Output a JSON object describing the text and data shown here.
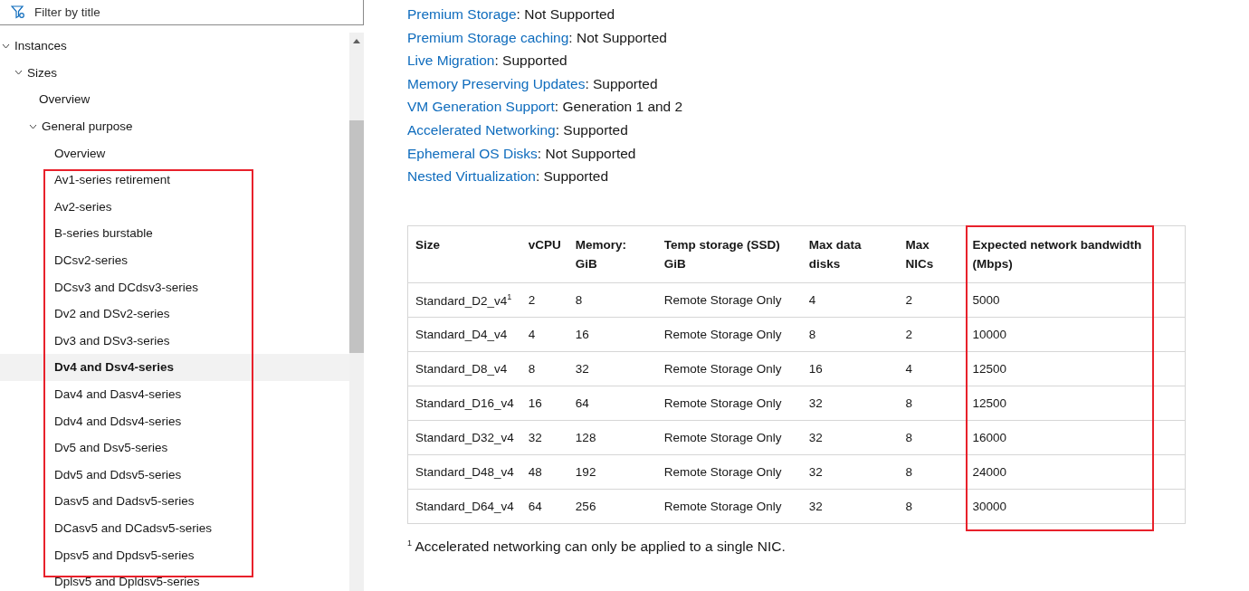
{
  "sidebar": {
    "filter": {
      "placeholder": "Filter by title"
    },
    "tree": [
      {
        "label": "Instances",
        "expanded": true,
        "selected": false,
        "children": [
          {
            "label": "Sizes",
            "expanded": true,
            "selected": false,
            "children": [
              {
                "label": "Overview",
                "selected": false
              },
              {
                "label": "General purpose",
                "expanded": true,
                "selected": false,
                "children": [
                  {
                    "label": "Overview",
                    "selected": false
                  },
                  {
                    "label": "Av1-series retirement",
                    "selected": false
                  },
                  {
                    "label": "Av2-series",
                    "selected": false
                  },
                  {
                    "label": "B-series burstable",
                    "selected": false
                  },
                  {
                    "label": "DCsv2-series",
                    "selected": false
                  },
                  {
                    "label": "DCsv3 and DCdsv3-series",
                    "selected": false
                  },
                  {
                    "label": "Dv2 and DSv2-series",
                    "selected": false
                  },
                  {
                    "label": "Dv3 and DSv3-series",
                    "selected": false
                  },
                  {
                    "label": "Dv4 and Dsv4-series",
                    "selected": true
                  },
                  {
                    "label": "Dav4 and Dasv4-series",
                    "selected": false
                  },
                  {
                    "label": "Ddv4 and Ddsv4-series",
                    "selected": false
                  },
                  {
                    "label": "Dv5 and Dsv5-series",
                    "selected": false
                  },
                  {
                    "label": "Ddv5 and Ddsv5-series",
                    "selected": false
                  },
                  {
                    "label": "Dasv5 and Dadsv5-series",
                    "selected": false
                  },
                  {
                    "label": "DCasv5 and DCadsv5-series",
                    "selected": false
                  },
                  {
                    "label": "Dpsv5 and Dpdsv5-series",
                    "selected": false
                  },
                  {
                    "label": "Dplsv5 and Dpldsv5-series",
                    "selected": false
                  }
                ]
              }
            ]
          }
        ]
      }
    ]
  },
  "features": [
    {
      "link": "Premium Storage",
      "text": ": Not Supported"
    },
    {
      "link": "Premium Storage caching",
      "text": ": Not Supported"
    },
    {
      "link": "Live Migration",
      "text": ": Supported"
    },
    {
      "link": "Memory Preserving Updates",
      "text": ": Supported"
    },
    {
      "link": "VM Generation Support",
      "text": ": Generation 1 and 2"
    },
    {
      "link": "Accelerated Networking",
      "text": ": Supported"
    },
    {
      "link": "Ephemeral OS Disks",
      "text": ": Not Supported"
    },
    {
      "link": "Nested Virtualization",
      "text": ": Supported"
    }
  ],
  "table": {
    "columns": [
      "Size",
      "vCPU",
      "Memory: GiB",
      "Temp storage (SSD) GiB",
      "Max data disks",
      "Max NICs",
      "Expected network bandwidth (Mbps)"
    ],
    "rows": [
      [
        "Standard_D2_v4$^{1}$",
        "2",
        "8",
        "Remote Storage Only",
        "4",
        "2",
        "5000"
      ],
      [
        "Standard_D4_v4",
        "4",
        "16",
        "Remote Storage Only",
        "8",
        "2",
        "10000"
      ],
      [
        "Standard_D8_v4",
        "8",
        "32",
        "Remote Storage Only",
        "16",
        "4",
        "12500"
      ],
      [
        "Standard_D16_v4",
        "16",
        "64",
        "Remote Storage Only",
        "32",
        "8",
        "12500"
      ],
      [
        "Standard_D32_v4",
        "32",
        "128",
        "Remote Storage Only",
        "32",
        "8",
        "16000"
      ],
      [
        "Standard_D48_v4",
        "48",
        "192",
        "Remote Storage Only",
        "32",
        "8",
        "24000"
      ],
      [
        "Standard_D64_v4",
        "64",
        "256",
        "Remote Storage Only",
        "32",
        "8",
        "30000"
      ]
    ]
  },
  "footnote": "$^{1}$ Accelerated networking can only be applied to a single NIC."
}
